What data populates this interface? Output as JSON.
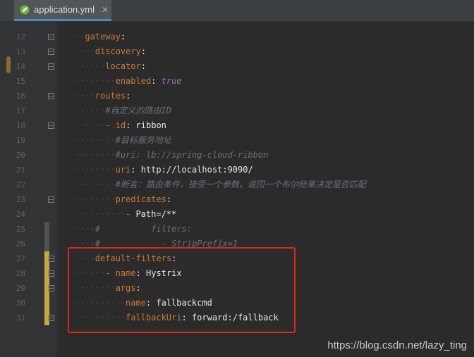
{
  "tab": {
    "label": "application.yml",
    "close": "✕",
    "icon": "spring-leaf-icon"
  },
  "colors": {
    "key": "#cc7832",
    "comment": "#6a7079",
    "bool": "#9876aa",
    "highlight": "#e0261b"
  },
  "lines": [
    {
      "n": "12",
      "indent": 2,
      "parts": [
        {
          "t": "gateway",
          "c": "key"
        },
        {
          "t": ":",
          "c": "str"
        }
      ]
    },
    {
      "n": "13",
      "indent": 4,
      "parts": [
        {
          "t": "discovery",
          "c": "key"
        },
        {
          "t": ":",
          "c": "str"
        }
      ]
    },
    {
      "n": "14",
      "indent": 6,
      "parts": [
        {
          "t": "locator",
          "c": "key"
        },
        {
          "t": ":",
          "c": "str"
        }
      ]
    },
    {
      "n": "15",
      "indent": 8,
      "parts": [
        {
          "t": "enabled",
          "c": "key"
        },
        {
          "t": ": ",
          "c": "str"
        },
        {
          "t": "true",
          "c": "kw"
        }
      ]
    },
    {
      "n": "16",
      "indent": 4,
      "parts": [
        {
          "t": "routes",
          "c": "key"
        },
        {
          "t": ":",
          "c": "str"
        }
      ]
    },
    {
      "n": "17",
      "indent": 6,
      "parts": [
        {
          "t": "#自定义的路由ID",
          "c": "cmt"
        }
      ]
    },
    {
      "n": "18",
      "indent": 6,
      "parts": [
        {
          "t": "- ",
          "c": "dash"
        },
        {
          "t": "id",
          "c": "key"
        },
        {
          "t": ": ribbon",
          "c": "str"
        }
      ]
    },
    {
      "n": "19",
      "indent": 8,
      "parts": [
        {
          "t": "#目标服务地址",
          "c": "cmt"
        }
      ]
    },
    {
      "n": "20",
      "indent": 8,
      "parts": [
        {
          "t": "#uri: lb://spring-cloud-ribbon",
          "c": "cmt"
        }
      ]
    },
    {
      "n": "21",
      "indent": 8,
      "parts": [
        {
          "t": "uri",
          "c": "key"
        },
        {
          "t": ": http://localhost:9090/",
          "c": "str"
        }
      ]
    },
    {
      "n": "22",
      "indent": 8,
      "parts": [
        {
          "t": "#断言：路由条件，接受一个参数，返回一个布尔结果决定是否匹配",
          "c": "cmt"
        }
      ]
    },
    {
      "n": "23",
      "indent": 8,
      "parts": [
        {
          "t": "predicates",
          "c": "key"
        },
        {
          "t": ":",
          "c": "str"
        }
      ]
    },
    {
      "n": "24",
      "indent": 10,
      "parts": [
        {
          "t": "- ",
          "c": "dash"
        },
        {
          "t": "Path=/**",
          "c": "str"
        }
      ]
    },
    {
      "n": "25",
      "indent": 4,
      "parts": [
        {
          "t": "#          filters:",
          "c": "cmt"
        }
      ]
    },
    {
      "n": "26",
      "indent": 4,
      "parts": [
        {
          "t": "#            - StripPrefix=1",
          "c": "cmt"
        }
      ]
    },
    {
      "n": "27",
      "indent": 4,
      "parts": [
        {
          "t": "default-filters",
          "c": "key"
        },
        {
          "t": ":",
          "c": "str"
        }
      ]
    },
    {
      "n": "28",
      "indent": 6,
      "parts": [
        {
          "t": "- ",
          "c": "dash"
        },
        {
          "t": "name",
          "c": "key"
        },
        {
          "t": ": Hystrix",
          "c": "str"
        }
      ]
    },
    {
      "n": "29",
      "indent": 8,
      "parts": [
        {
          "t": "args",
          "c": "key"
        },
        {
          "t": ":",
          "c": "str"
        }
      ]
    },
    {
      "n": "30",
      "indent": 10,
      "parts": [
        {
          "t": "name",
          "c": "key"
        },
        {
          "t": ": fallbackcmd",
          "c": "str"
        }
      ]
    },
    {
      "n": "31",
      "indent": 10,
      "parts": [
        {
          "t": "fallbackUri",
          "c": "key"
        },
        {
          "t": ": forward:/fallback",
          "c": "str"
        }
      ]
    }
  ],
  "watermark": "https://blog.csdn.net/lazy_ting"
}
